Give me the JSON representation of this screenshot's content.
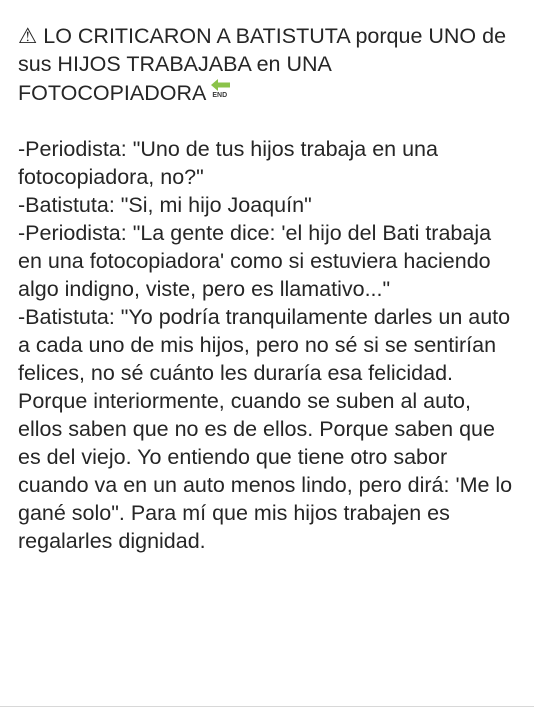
{
  "post": {
    "headline": "⚠ LO CRITICARON A BATISTUTA porque UNO de sus HIJOS TRABAJABA en UNA FOTOCOPIADORA",
    "headline_icon": "end-arrow-emoji-icon",
    "end_label": "END",
    "lines": [
      "-Periodista: \"Uno de tus hijos trabaja en una fotocopiadora, no?\"",
      "-Batistuta: \"Si, mi hijo Joaquín\"",
      "-Periodista: \"La gente dice: 'el hijo del Bati trabaja en una fotocopiadora' como si estuviera haciendo algo indigno, viste, pero es llamativo...\"",
      "-Batistuta: \"Yo podría tranquilamente darles un auto a cada uno de mis hijos, pero no sé si se sentirían felices, no sé cuánto les duraría esa felicidad.",
      "Porque interiormente, cuando se suben al auto, ellos saben que no es de ellos. Porque saben que es del viejo. Yo entiendo que tiene otro sabor cuando va en un auto menos lindo, pero dirá: 'Me lo gané solo\". Para mí que mis hijos trabajen es regalarles dignidad."
    ]
  },
  "colors": {
    "text": "#262626",
    "background": "#ffffff",
    "icon_green": "#8bc34a"
  }
}
